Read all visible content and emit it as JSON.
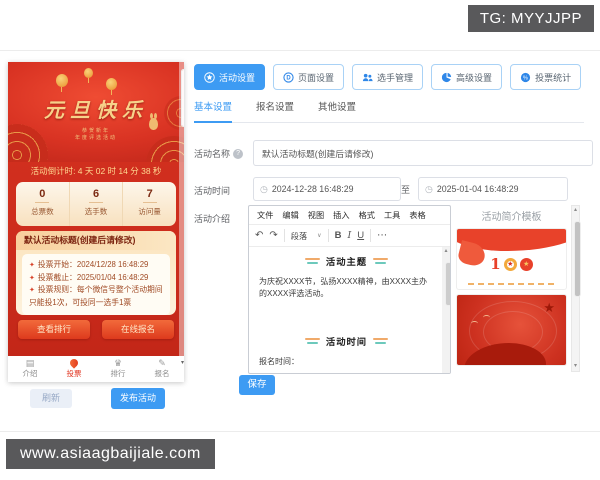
{
  "badges": {
    "tg": "TG: MYYJJPP",
    "url": "www.asiaagbaijiale.com"
  },
  "preview": {
    "banner": {
      "title": "元旦快乐",
      "subtitle1": "恭贺新年",
      "subtitle2": "年度评选活动"
    },
    "countdown": "活动倒计时: 4 天 02 时 14 分 38 秒",
    "stats": [
      {
        "value": "0",
        "label": "总票数"
      },
      {
        "value": "6",
        "label": "选手数"
      },
      {
        "value": "7",
        "label": "访问量"
      }
    ],
    "card": {
      "title": "默认活动标题(创建后请修改)",
      "items": [
        {
          "bullet": "✦",
          "label": "投票开始：",
          "value": "2024/12/28 16:48:29"
        },
        {
          "bullet": "✦",
          "label": "投票截止：",
          "value": "2025/01/04 16:48:29"
        },
        {
          "bullet": "✦",
          "label": "投票规则：",
          "value": "每个微信号整个活动期间只能投1次，可投同一选手1票"
        }
      ]
    },
    "buttons": {
      "rank": "查看排行",
      "signup": "在线报名"
    },
    "nav": [
      {
        "label": "介绍"
      },
      {
        "label": "投票"
      },
      {
        "label": "排行"
      },
      {
        "label": "报名"
      }
    ],
    "actions": {
      "refresh": "刷新",
      "publish": "发布活动"
    }
  },
  "toolbar": {
    "buttons": [
      {
        "label": "活动设置"
      },
      {
        "label": "页面设置"
      },
      {
        "label": "选手管理"
      },
      {
        "label": "高级设置"
      },
      {
        "label": "投票统计"
      }
    ]
  },
  "tabs": [
    {
      "label": "基本设置"
    },
    {
      "label": "报名设置"
    },
    {
      "label": "其他设置"
    }
  ],
  "form": {
    "name_label": "活动名称",
    "name_value": "默认活动标题(创建后请修改)",
    "time_label": "活动时间",
    "time_start": "2024-12-28 16:48:29",
    "time_separator": "至",
    "time_end": "2025-01-04 16:48:29",
    "intro_label": "活动介绍",
    "save": "保存"
  },
  "editor": {
    "menus": [
      "文件",
      "编辑",
      "视图",
      "插入",
      "格式",
      "工具",
      "表格"
    ],
    "undo": "↶",
    "redo": "↷",
    "paragraph": "段落",
    "bold": "B",
    "italic": "I",
    "underline": "U",
    "more": "⋯",
    "content": {
      "heading1": "活动主题",
      "paragraph1": "为庆祝XXXX节，弘扬XXXX精神，由XXXX主办的XXXX评选活动。",
      "heading2": "活动时间",
      "paragraph2": "报名时间："
    }
  },
  "template_panel": {
    "title": "活动简介模板"
  },
  "colors": {
    "accent": "#3d9bf3",
    "red": "#d63220",
    "gold": "#f7d28a",
    "badge_gray": "#59595b"
  }
}
